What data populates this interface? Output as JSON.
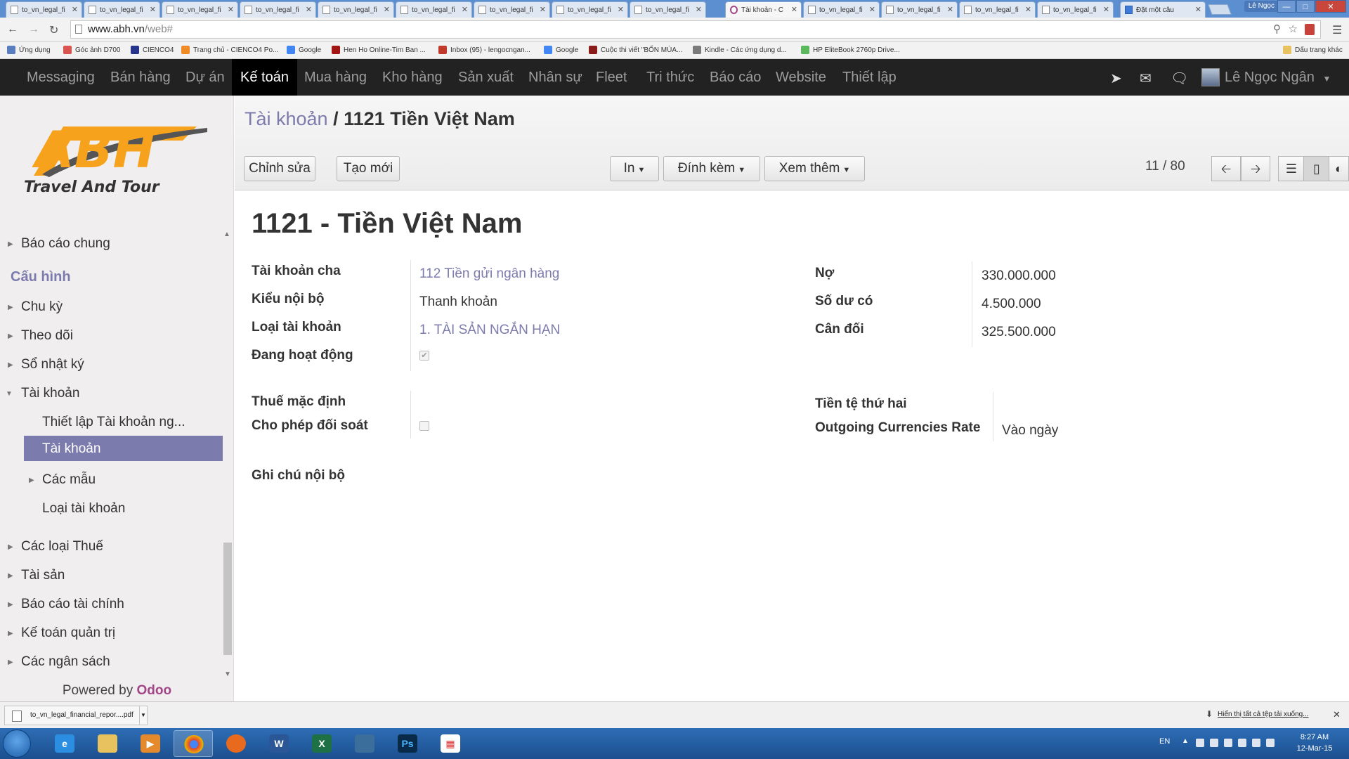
{
  "browser": {
    "tabs": [
      {
        "label": "to_vn_legal_fi"
      },
      {
        "label": "to_vn_legal_fi"
      },
      {
        "label": "to_vn_legal_fi"
      },
      {
        "label": "to_vn_legal_fi"
      },
      {
        "label": "to_vn_legal_fi"
      },
      {
        "label": "to_vn_legal_fi"
      },
      {
        "label": "to_vn_legal_fi"
      },
      {
        "label": "to_vn_legal_fi"
      },
      {
        "label": "to_vn_legal_fi"
      },
      {
        "label": "Tài khoản - C"
      },
      {
        "label": "to_vn_legal_fi"
      },
      {
        "label": "to_vn_legal_fi"
      },
      {
        "label": "to_vn_legal_fi"
      },
      {
        "label": "to_vn_legal_fi"
      },
      {
        "label": "Đặt một câu"
      }
    ],
    "profile_name": "Lê Ngọc",
    "url_host": "www.abh.vn",
    "url_path": "/web#",
    "bookmarks": [
      {
        "label": "Ứng dụng"
      },
      {
        "label": "Góc ảnh D700"
      },
      {
        "label": "CIENCO4"
      },
      {
        "label": "Trang chủ - CIENCO4 Po..."
      },
      {
        "label": "Google"
      },
      {
        "label": "Hen Ho Online-Tim Ban ..."
      },
      {
        "label": "Inbox (95) - lengocngan..."
      },
      {
        "label": "Google"
      },
      {
        "label": "Cuộc thi viết \"BỐN MÙA..."
      },
      {
        "label": "Kindle - Các ứng dụng d..."
      },
      {
        "label": "HP EliteBook 2760p Drive..."
      }
    ],
    "other_bookmarks": "Dấu trang khác"
  },
  "topbar": {
    "menu": [
      "Messaging",
      "Bán hàng",
      "Dự án",
      "Kế toán",
      "Mua hàng",
      "Kho hàng",
      "Sản xuất",
      "Nhân sự",
      "Fleet",
      "Tri thức",
      "Báo cáo",
      "Website",
      "Thiết lập"
    ],
    "active_index": 3,
    "user_name": "Lê Ngọc Ngân"
  },
  "sidebar": {
    "logo_main": "ABH",
    "logo_sub": "Travel And Tour",
    "items": {
      "bao_cao_chung": "Báo cáo chung",
      "cau_hinh": "Cấu hình",
      "chu_ky": "Chu kỳ",
      "theo_doi": "Theo dõi",
      "so_nhat_ky": "Sổ nhật ký",
      "tai_khoan": "Tài khoản",
      "thiet_lap_tk": "Thiết lập Tài khoản ng...",
      "tai_khoan_sub": "Tài khoản",
      "cac_mau": "Các mẫu",
      "loai_tai_khoan": "Loại tài khoản",
      "cac_loai_thue": "Các loại Thuế",
      "tai_san": "Tài sản",
      "bao_cao_tai_chinh": "Báo cáo tài chính",
      "ke_toan_quan_tri": "Kế toán quản trị",
      "cac_ngan_sach": "Các ngân sách"
    },
    "powered_by": "Powered by",
    "powered_brand": "Odoo"
  },
  "header": {
    "breadcrumb_link": "Tài khoản",
    "breadcrumb_sep": "/",
    "breadcrumb_current": "1121 Tiền Việt Nam",
    "buttons": {
      "edit": "Chỉnh sửa",
      "create": "Tạo mới",
      "print": "In",
      "attach": "Đính kèm",
      "more": "Xem thêm"
    },
    "pager": "11 / 80"
  },
  "form": {
    "title": "1121  - Tiền Việt Nam",
    "fields": {
      "parent_label": "Tài khoản cha",
      "parent_value": "112 Tiền gửi ngân hàng",
      "internal_type_label": "Kiểu nội bộ",
      "internal_type_value": "Thanh khoản",
      "account_type_label": "Loại tài khoản",
      "account_type_value": "1. TÀI SẢN NGẮN HẠN",
      "active_label": "Đang hoạt động",
      "debit_label": "Nợ",
      "debit_value": "330.000.000",
      "credit_label": "Số dư có",
      "credit_value": "4.500.000",
      "balance_label": "Cân đối",
      "balance_value": "325.500.000",
      "default_tax_label": "Thuế mặc định",
      "reconcile_label": "Cho phép đối soát",
      "secondary_currency_label": "Tiền tệ thứ hai",
      "outgoing_rate_label": "Outgoing Currencies Rate",
      "outgoing_rate_value": "Vào ngày",
      "internal_note_label": "Ghi chú nội bộ"
    },
    "active_checked": true,
    "reconcile_checked": false
  },
  "download_bar": {
    "file": "to_vn_legal_financial_repor....pdf",
    "show_all": "Hiển thị tất cả tệp tải xuống..."
  },
  "taskbar": {
    "lang": "EN",
    "time": "8:27 AM",
    "date": "12-Mar-15"
  }
}
